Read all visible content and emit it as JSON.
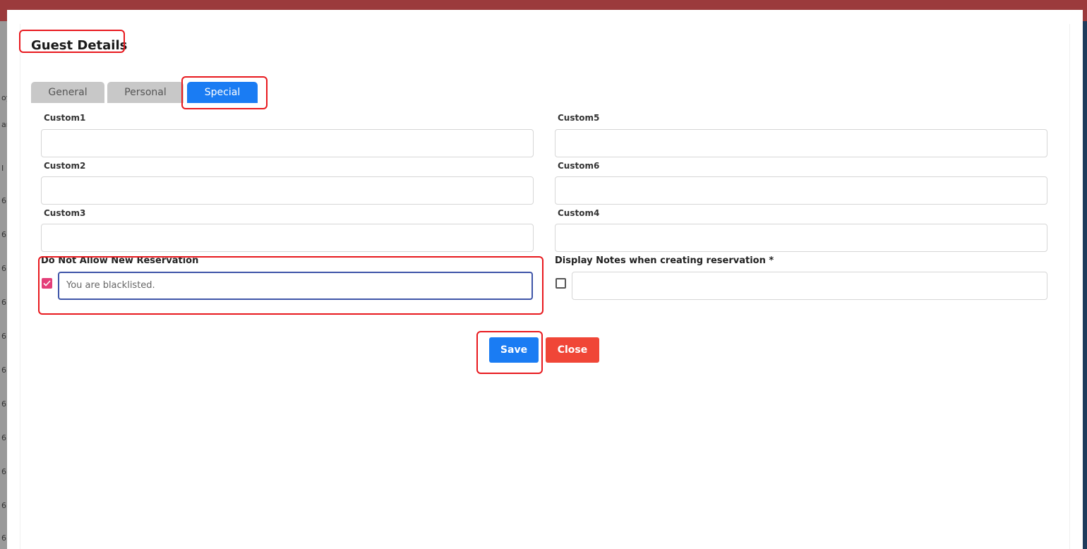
{
  "dialog": {
    "title": "Guest Details"
  },
  "tabs": [
    {
      "label": "General",
      "active": false
    },
    {
      "label": "Personal",
      "active": false
    },
    {
      "label": "Special",
      "active": true
    }
  ],
  "form": {
    "custom1": {
      "label": "Custom1",
      "value": ""
    },
    "custom2": {
      "label": "Custom2",
      "value": ""
    },
    "custom3": {
      "label": "Custom3",
      "value": ""
    },
    "custom4": {
      "label": "Custom4",
      "value": ""
    },
    "custom5": {
      "label": "Custom5",
      "value": ""
    },
    "custom6": {
      "label": "Custom6",
      "value": ""
    },
    "do_not_allow": {
      "label": "Do Not Allow New Reservation",
      "checked": true,
      "value": "You are blacklisted."
    },
    "display_notes": {
      "label": "Display Notes when creating reservation *",
      "checked": false,
      "value": ""
    }
  },
  "buttons": {
    "save": "Save",
    "close": "Close"
  },
  "background_fragments": [
    "oy",
    "an",
    "I",
    "6",
    "6",
    "6",
    "6",
    "6",
    "6",
    "6",
    "6",
    "6",
    "6",
    "6"
  ],
  "colors": {
    "primary": "#1a7cf3",
    "danger": "#f04637",
    "highlight": "#e8191e",
    "checkbox_checked": "#e43f79",
    "header_bar": "#9b3a3c"
  }
}
